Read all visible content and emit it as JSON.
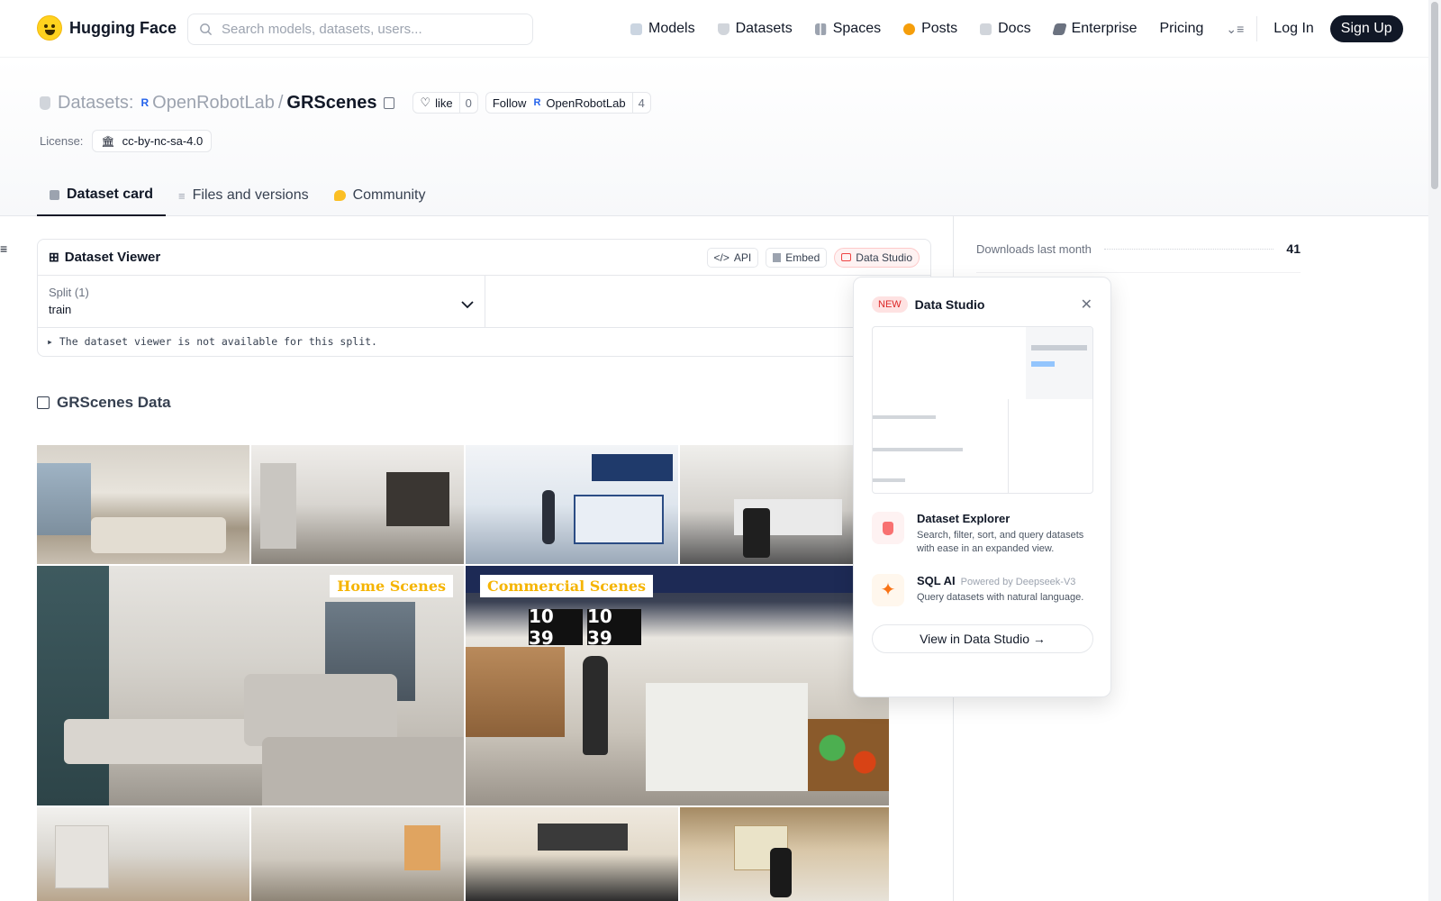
{
  "nav": {
    "logo_text": "Hugging Face",
    "search_placeholder": "Search models, datasets, users...",
    "links": [
      {
        "label": "Models",
        "icon": "models-icon",
        "color": "#9ca3af"
      },
      {
        "label": "Datasets",
        "icon": "datasets-icon",
        "color": "#d1d5db"
      },
      {
        "label": "Spaces",
        "icon": "spaces-icon",
        "color": "#9ca3af"
      },
      {
        "label": "Posts",
        "icon": "posts-icon",
        "color": "#f59e0b"
      },
      {
        "label": "Docs",
        "icon": "docs-icon",
        "color": "#9ca3af"
      },
      {
        "label": "Enterprise",
        "icon": "enterprise-icon",
        "color": "#6b7280"
      },
      {
        "label": "Pricing",
        "icon": "",
        "color": ""
      }
    ],
    "login": "Log In",
    "signup": "Sign Up"
  },
  "header": {
    "section": "Datasets:",
    "org": "OpenRobotLab",
    "separator": "/",
    "name": "GRScenes",
    "like_label": "like",
    "like_count": "0",
    "follow_label": "Follow",
    "follow_org": "OpenRobotLab",
    "follow_count": "4",
    "license_label": "License:",
    "license_value": "cc-by-nc-sa-4.0"
  },
  "tabs": [
    {
      "label": "Dataset card",
      "active": true
    },
    {
      "label": "Files and versions",
      "active": false
    },
    {
      "label": "Community",
      "active": false
    }
  ],
  "viewer": {
    "title": "Dataset Viewer",
    "api_label": "API",
    "embed_label": "Embed",
    "studio_label": "Data Studio",
    "split_label": "Split (1)",
    "split_value": "train",
    "note": "The dataset viewer is not available for this split."
  },
  "section_title": "GRScenes Data",
  "collage": {
    "home_label": "Home Scenes",
    "commercial_label": "Commercial Scenes",
    "banner_numbers": [
      "10 39",
      "10 39"
    ]
  },
  "sidebar": {
    "downloads_label": "Downloads last month",
    "downloads_value": "41"
  },
  "popover": {
    "badge": "NEW",
    "title": "Data Studio",
    "explorer_title": "Dataset Explorer",
    "explorer_desc": "Search, filter, sort, and query datasets with ease in an expanded view.",
    "sqlai_title": "SQL AI",
    "sqlai_sub": "Powered by Deepseek-V3",
    "sqlai_desc": "Query datasets with natural language.",
    "button": "View in Data Studio →"
  },
  "colors": {
    "accent_dark": "#111827",
    "brand_yellow": "#ffd21e",
    "studio_red": "#ef4444"
  }
}
